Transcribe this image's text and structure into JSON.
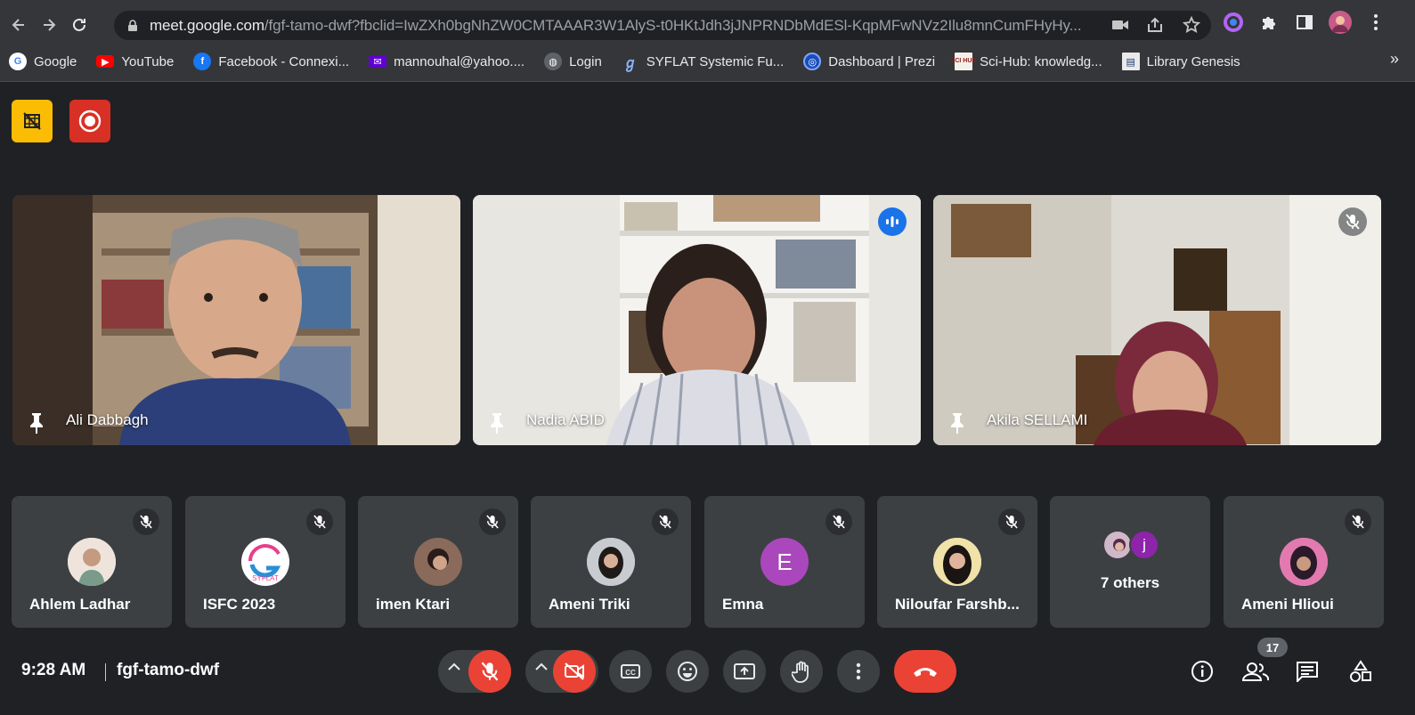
{
  "browser": {
    "url_host": "meet.google.com",
    "url_rest": "/fgf-tamo-dwf?fbclid=IwZXh0bgNhZW0CMTAAAR3W1AlyS-t0HKtJdh3jJNPRNDbMdESl-KqpMFwNVz2Ilu8mnCumFHyHy...",
    "bookmarks": [
      {
        "label": "Google",
        "icon": "google-icon"
      },
      {
        "label": "YouTube",
        "icon": "youtube-icon"
      },
      {
        "label": "Facebook - Connexi...",
        "icon": "facebook-icon"
      },
      {
        "label": "mannouhal@yahoo....",
        "icon": "yahoo-mail-icon"
      },
      {
        "label": "Login",
        "icon": "globe-icon"
      },
      {
        "label": "SYFLAT Systemic Fu...",
        "icon": "syflat-icon"
      },
      {
        "label": "Dashboard | Prezi",
        "icon": "prezi-icon"
      },
      {
        "label": "Sci-Hub: knowledg...",
        "icon": "scihub-icon"
      },
      {
        "label": "Library Genesis",
        "icon": "libgen-icon"
      }
    ],
    "scihub_fav_text": "SCI HUB",
    "more": "»"
  },
  "meet": {
    "featured": [
      {
        "name": "Ali Dabbagh",
        "speaking": false,
        "muted": false
      },
      {
        "name": "Nadia ABID",
        "speaking": true,
        "muted": false
      },
      {
        "name": "Akila SELLAMI",
        "speaking": false,
        "muted": true
      }
    ],
    "participants": [
      {
        "name": "Ahlem Ladhar",
        "muted": true
      },
      {
        "name": "ISFC 2023",
        "muted": true,
        "logo_text": "SYFLAT"
      },
      {
        "name": "imen Ktari",
        "muted": true
      },
      {
        "name": "Ameni Triki",
        "muted": true
      },
      {
        "name": "Emna",
        "muted": true,
        "initial": "E"
      },
      {
        "name": "Niloufar Farshb...",
        "muted": true
      },
      {
        "name": "7 others",
        "initial": "j"
      },
      {
        "name": "Ameni Hlioui",
        "muted": true
      }
    ],
    "time": "9:28 AM",
    "code": "fgf-tamo-dwf",
    "participant_count": "17"
  },
  "colors": {
    "accent_blue": "#8ab4f8",
    "red": "#ea4335",
    "yellow": "#fbbc04",
    "bg": "#202124",
    "tile": "#3c4043"
  }
}
